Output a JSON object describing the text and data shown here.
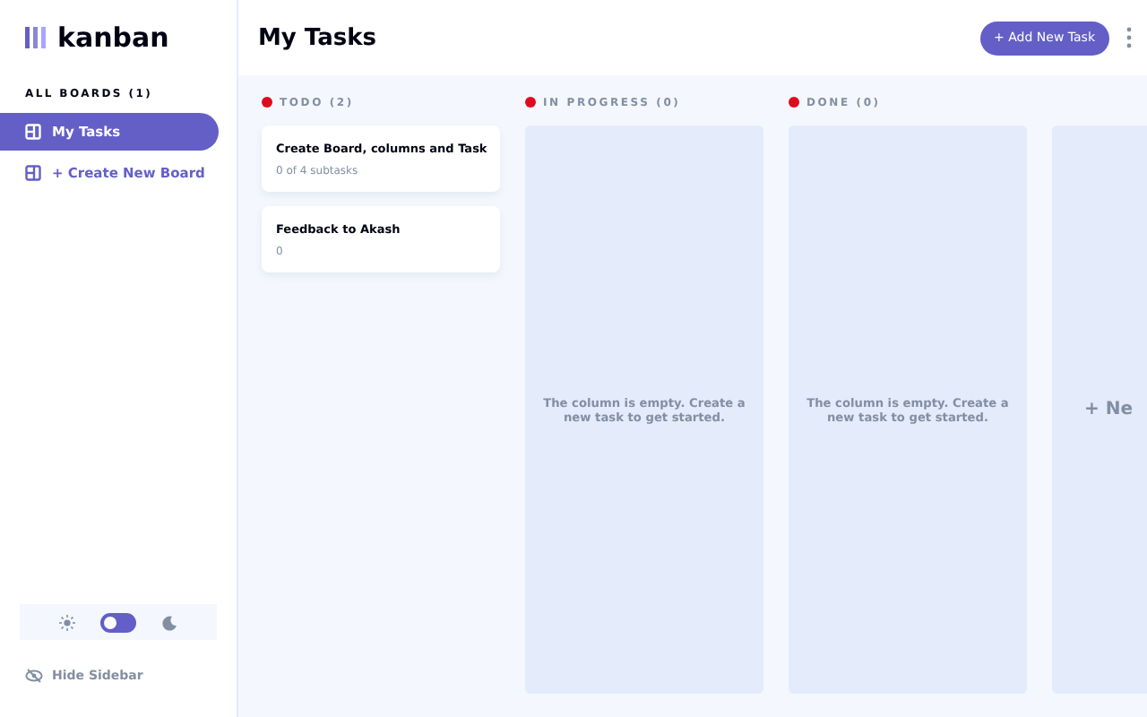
{
  "logo": {
    "text": "kanban"
  },
  "sidebar": {
    "heading": "ALL BOARDS (1)",
    "boards": [
      {
        "label": "My Tasks",
        "selected": true
      }
    ],
    "create_board": "+ Create New Board",
    "theme_toggle": {
      "on": false
    },
    "hide_sidebar": "Hide Sidebar"
  },
  "header": {
    "title": "My Tasks",
    "add_task": "+ Add New Task"
  },
  "columns": [
    {
      "title": "TODO (2)",
      "color": "#e00a1e",
      "tasks": [
        {
          "title": "Create Board, columns and Task",
          "subtasks": "0 of 4 subtasks"
        },
        {
          "title": "Feedback to Akash",
          "subtasks": "0"
        }
      ]
    },
    {
      "title": "IN PROGRESS (0)",
      "color": "#e00a1e",
      "empty_message": "The column is empty. Create a new task to get started."
    },
    {
      "title": "DONE (0)",
      "color": "#e00a1e",
      "empty_message": "The column is empty. Create a new task to get started."
    }
  ],
  "new_column": "+ Ne"
}
